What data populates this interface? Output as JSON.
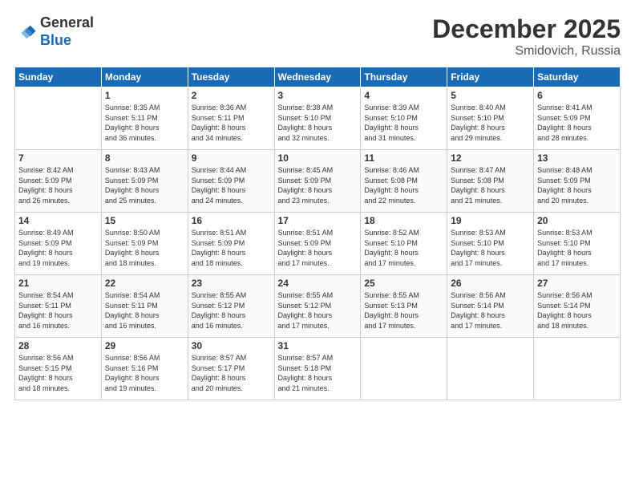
{
  "header": {
    "logo_line1": "General",
    "logo_line2": "Blue",
    "month": "December 2025",
    "location": "Smidovich, Russia"
  },
  "days_of_week": [
    "Sunday",
    "Monday",
    "Tuesday",
    "Wednesday",
    "Thursday",
    "Friday",
    "Saturday"
  ],
  "weeks": [
    [
      {
        "day": "",
        "info": ""
      },
      {
        "day": "1",
        "info": "Sunrise: 8:35 AM\nSunset: 5:11 PM\nDaylight: 8 hours\nand 36 minutes."
      },
      {
        "day": "2",
        "info": "Sunrise: 8:36 AM\nSunset: 5:11 PM\nDaylight: 8 hours\nand 34 minutes."
      },
      {
        "day": "3",
        "info": "Sunrise: 8:38 AM\nSunset: 5:10 PM\nDaylight: 8 hours\nand 32 minutes."
      },
      {
        "day": "4",
        "info": "Sunrise: 8:39 AM\nSunset: 5:10 PM\nDaylight: 8 hours\nand 31 minutes."
      },
      {
        "day": "5",
        "info": "Sunrise: 8:40 AM\nSunset: 5:10 PM\nDaylight: 8 hours\nand 29 minutes."
      },
      {
        "day": "6",
        "info": "Sunrise: 8:41 AM\nSunset: 5:09 PM\nDaylight: 8 hours\nand 28 minutes."
      }
    ],
    [
      {
        "day": "7",
        "info": "Sunrise: 8:42 AM\nSunset: 5:09 PM\nDaylight: 8 hours\nand 26 minutes."
      },
      {
        "day": "8",
        "info": "Sunrise: 8:43 AM\nSunset: 5:09 PM\nDaylight: 8 hours\nand 25 minutes."
      },
      {
        "day": "9",
        "info": "Sunrise: 8:44 AM\nSunset: 5:09 PM\nDaylight: 8 hours\nand 24 minutes."
      },
      {
        "day": "10",
        "info": "Sunrise: 8:45 AM\nSunset: 5:09 PM\nDaylight: 8 hours\nand 23 minutes."
      },
      {
        "day": "11",
        "info": "Sunrise: 8:46 AM\nSunset: 5:08 PM\nDaylight: 8 hours\nand 22 minutes."
      },
      {
        "day": "12",
        "info": "Sunrise: 8:47 AM\nSunset: 5:08 PM\nDaylight: 8 hours\nand 21 minutes."
      },
      {
        "day": "13",
        "info": "Sunrise: 8:48 AM\nSunset: 5:09 PM\nDaylight: 8 hours\nand 20 minutes."
      }
    ],
    [
      {
        "day": "14",
        "info": "Sunrise: 8:49 AM\nSunset: 5:09 PM\nDaylight: 8 hours\nand 19 minutes."
      },
      {
        "day": "15",
        "info": "Sunrise: 8:50 AM\nSunset: 5:09 PM\nDaylight: 8 hours\nand 18 minutes."
      },
      {
        "day": "16",
        "info": "Sunrise: 8:51 AM\nSunset: 5:09 PM\nDaylight: 8 hours\nand 18 minutes."
      },
      {
        "day": "17",
        "info": "Sunrise: 8:51 AM\nSunset: 5:09 PM\nDaylight: 8 hours\nand 17 minutes."
      },
      {
        "day": "18",
        "info": "Sunrise: 8:52 AM\nSunset: 5:10 PM\nDaylight: 8 hours\nand 17 minutes."
      },
      {
        "day": "19",
        "info": "Sunrise: 8:53 AM\nSunset: 5:10 PM\nDaylight: 8 hours\nand 17 minutes."
      },
      {
        "day": "20",
        "info": "Sunrise: 8:53 AM\nSunset: 5:10 PM\nDaylight: 8 hours\nand 17 minutes."
      }
    ],
    [
      {
        "day": "21",
        "info": "Sunrise: 8:54 AM\nSunset: 5:11 PM\nDaylight: 8 hours\nand 16 minutes."
      },
      {
        "day": "22",
        "info": "Sunrise: 8:54 AM\nSunset: 5:11 PM\nDaylight: 8 hours\nand 16 minutes."
      },
      {
        "day": "23",
        "info": "Sunrise: 8:55 AM\nSunset: 5:12 PM\nDaylight: 8 hours\nand 16 minutes."
      },
      {
        "day": "24",
        "info": "Sunrise: 8:55 AM\nSunset: 5:12 PM\nDaylight: 8 hours\nand 17 minutes."
      },
      {
        "day": "25",
        "info": "Sunrise: 8:55 AM\nSunset: 5:13 PM\nDaylight: 8 hours\nand 17 minutes."
      },
      {
        "day": "26",
        "info": "Sunrise: 8:56 AM\nSunset: 5:14 PM\nDaylight: 8 hours\nand 17 minutes."
      },
      {
        "day": "27",
        "info": "Sunrise: 8:56 AM\nSunset: 5:14 PM\nDaylight: 8 hours\nand 18 minutes."
      }
    ],
    [
      {
        "day": "28",
        "info": "Sunrise: 8:56 AM\nSunset: 5:15 PM\nDaylight: 8 hours\nand 18 minutes."
      },
      {
        "day": "29",
        "info": "Sunrise: 8:56 AM\nSunset: 5:16 PM\nDaylight: 8 hours\nand 19 minutes."
      },
      {
        "day": "30",
        "info": "Sunrise: 8:57 AM\nSunset: 5:17 PM\nDaylight: 8 hours\nand 20 minutes."
      },
      {
        "day": "31",
        "info": "Sunrise: 8:57 AM\nSunset: 5:18 PM\nDaylight: 8 hours\nand 21 minutes."
      },
      {
        "day": "",
        "info": ""
      },
      {
        "day": "",
        "info": ""
      },
      {
        "day": "",
        "info": ""
      }
    ]
  ]
}
